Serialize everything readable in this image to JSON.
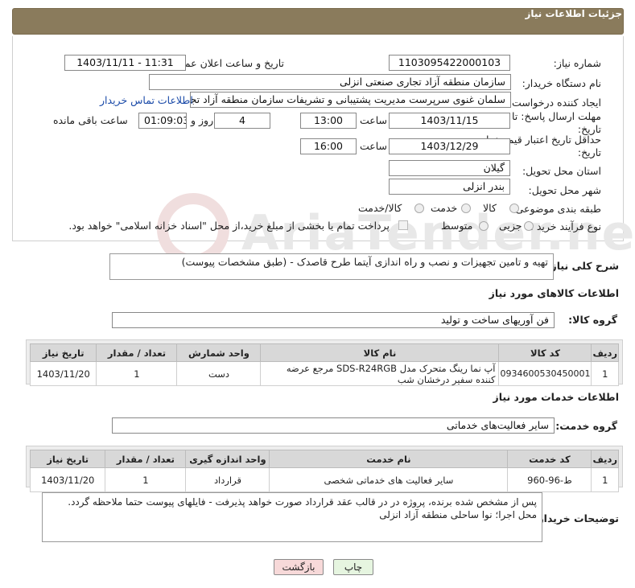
{
  "panel": {
    "title": "جزئیات اطلاعات نیاز"
  },
  "fields": {
    "need_number_label": "شماره نیاز:",
    "need_number": "1103095422000103",
    "announce_label": "تاریخ و ساعت اعلان عمومی:",
    "announce_value": "1403/11/11 - 11:31",
    "buyer_org_label": "نام دستگاه خریدار:",
    "buyer_org": "سازمان منطقه آزاد تجاری  صنعتی انزلی",
    "creator_label": "ایجاد کننده درخواست:",
    "creator": "سلمان غنوی سرپرست مدیریت پشتیبانی و تشریفات سازمان منطقه آزاد تجاری",
    "contact_link": "اطلاعات تماس خریدار",
    "deadline_label": "مهلت ارسال پاسخ: تا",
    "deadline_label2": "تاریخ:",
    "deadline_date": "1403/11/15",
    "time_label": "ساعت",
    "deadline_time": "13:00",
    "days_value": "4",
    "days_label": "روز و",
    "remaining_value": "01:09:03",
    "remaining_label": "ساعت باقی مانده",
    "validity_label": "حداقل تاریخ اعتبار قیمت: تا",
    "validity_label2": "تاریخ:",
    "validity_date": "1403/12/29",
    "validity_time": "16:00",
    "province_label": "استان محل تحویل:",
    "province": "گیلان",
    "city_label": "شهر محل تحویل:",
    "city": "بندر انزلی",
    "category_label": "طبقه بندی موضوعی:",
    "category_options": [
      "کالا",
      "خدمت",
      "کالا/خدمت"
    ],
    "process_label": "نوع فرآیند خرید :",
    "process_options": [
      "جزیی",
      "متوسط"
    ],
    "payment_note": "پرداخت تمام یا بخشی از مبلغ خرید،از محل \"اسناد خزانه اسلامی\" خواهد بود."
  },
  "description": {
    "label": "شرح کلی نیاز:",
    "value": "تهیه  و تامین تجهیزات و نصب و راه اندازی آیتما طرح قاصدک - (طبق مشخصات پیوست)"
  },
  "goods": {
    "section_title": "اطلاعات کالاهای مورد نیاز",
    "group_label": "گروه کالا:",
    "group_value": "فن آوریهای ساخت و تولید",
    "headers": [
      "ردیف",
      "کد کالا",
      "نام کالا",
      "واحد شمارش",
      "تعداد / مقدار",
      "تاریخ نیاز"
    ],
    "rows": [
      [
        "1",
        "0934600530450001",
        "آپ نما رینگ متحرک مدل SDS-R24RGB مرجع عرضه کننده سفیر درخشان شب",
        "دست",
        "1",
        "1403/11/20"
      ]
    ]
  },
  "services": {
    "section_title": "اطلاعات خدمات مورد نیاز",
    "group_label": "گروه خدمت:",
    "group_value": "سایر فعالیت‌های خدماتی",
    "headers": [
      "ردیف",
      "کد خدمت",
      "نام خدمت",
      "واحد اندازه گیری",
      "تعداد / مقدار",
      "تاریخ نیاز"
    ],
    "rows": [
      [
        "1",
        "ط-96-960",
        "سایر فعالیت های خدماتی شخصی",
        "قرارداد",
        "1",
        "1403/11/20"
      ]
    ]
  },
  "buyer_notes": {
    "label": "توضیحات خریدار:",
    "line1": "پس از مشخص شده برنده، پروژه در در قالب عقد قرارداد صورت خواهد پذیرفت - فایلهای پیوست حتما ملاحظه گردد.",
    "line2": "محل اجرا؛ نوا ساحلی منطقه آزاد انزلی"
  },
  "buttons": {
    "print": "چاپ",
    "back": "بازگشت"
  },
  "watermark": "AriaTender.net",
  "colors": {
    "panel": "#8a7b5c",
    "link": "#1a4aa8",
    "back_button": "#f7d9d9",
    "print_button": "#e6f5e0"
  }
}
